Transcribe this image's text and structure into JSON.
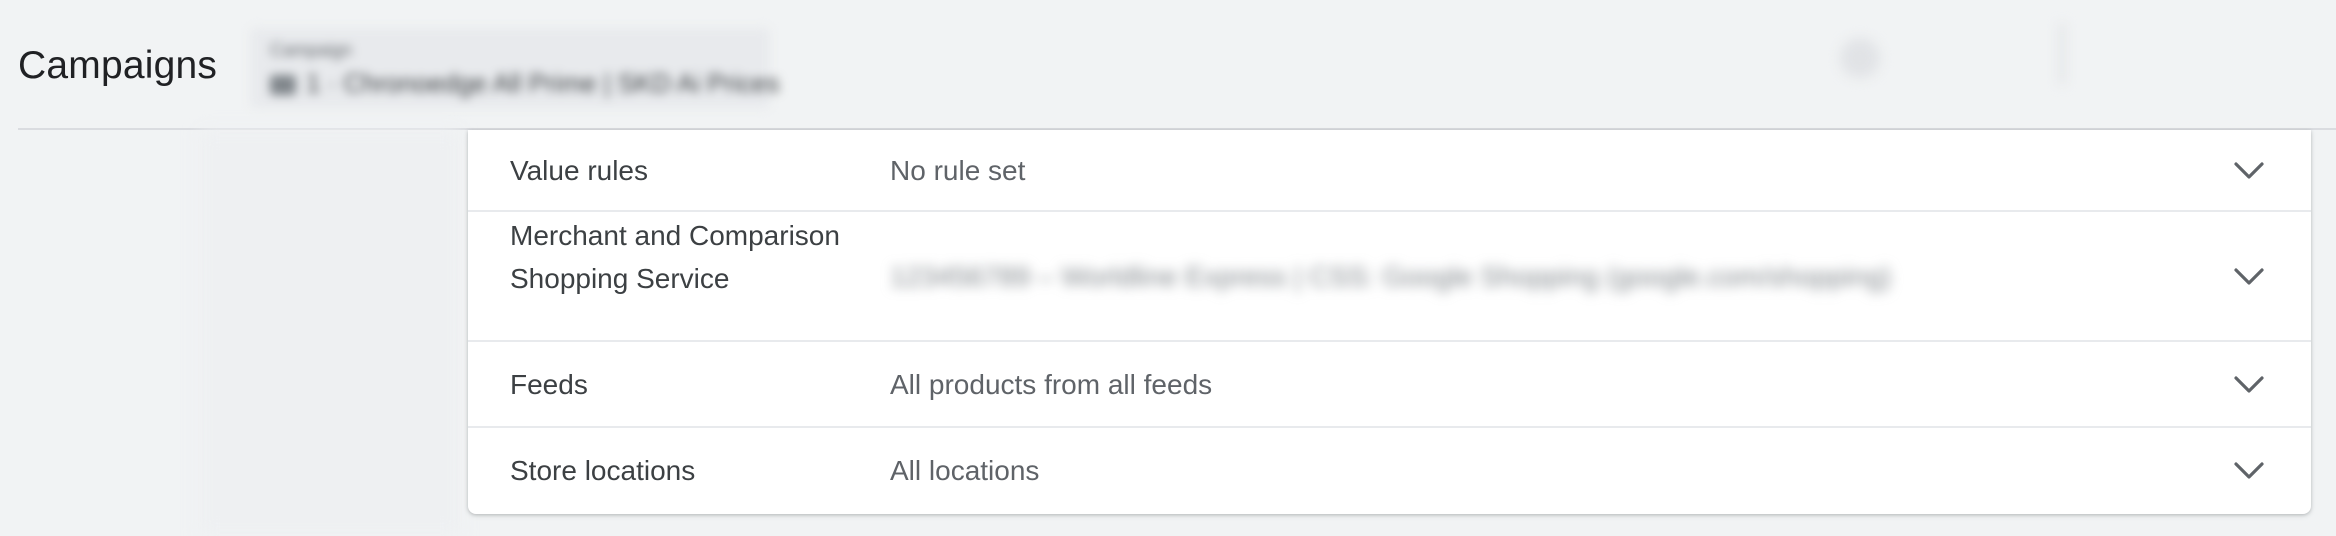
{
  "header": {
    "title": "Campaigns",
    "campaign_picker": {
      "caption": "Campaign",
      "value": "1 · Chronoedge All Prime | SKD Ai Prices",
      "icon": "campaign-type-icon"
    }
  },
  "settings": {
    "rows": [
      {
        "label": "Value rules",
        "value": "No rule set",
        "icon": "chevron-down-icon"
      },
      {
        "label": "Merchant and Comparison Shopping Service",
        "value": "123456789 – Worldline Express | CSS: Google Shopping (google.com/shopping)",
        "icon": "chevron-down-icon"
      },
      {
        "label": "Feeds",
        "value": "All products from all feeds",
        "icon": "chevron-down-icon"
      },
      {
        "label": "Store locations",
        "value": "All locations",
        "icon": "chevron-down-icon"
      }
    ]
  },
  "colors": {
    "background": "#f1f3f4",
    "card": "#ffffff",
    "label_text": "#3c4043",
    "value_text": "#5f6368",
    "divider": "#e8eaed",
    "chevron": "#5f6368"
  }
}
